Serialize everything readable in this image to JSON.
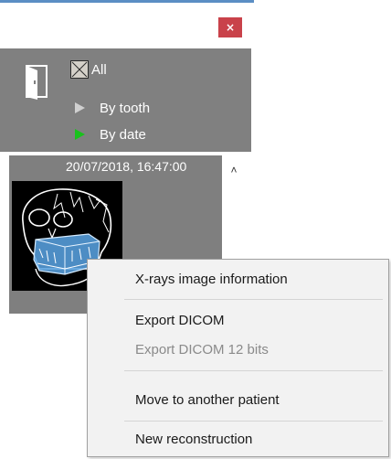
{
  "window": {
    "close_glyph": "×",
    "accent_line_color": "#5b8ec4",
    "close_color": "#c9424a"
  },
  "filters": {
    "all_label": "All",
    "by_tooth_label": "By tooth",
    "by_date_label": "By date",
    "panel_color": "#808080",
    "active_color": "#19c21c",
    "active_filter": "By date"
  },
  "images": [
    {
      "datetime": "20/07/2018, 16:47:00",
      "thumbnail": "skull-xray-3d-icon"
    }
  ],
  "scroll": {
    "up_glyph": "˄"
  },
  "context_menu": {
    "items": [
      {
        "label": "X-rays image information",
        "enabled": true
      },
      {
        "label": "Export DICOM",
        "enabled": true
      },
      {
        "label": "Export DICOM 12 bits",
        "enabled": false
      },
      {
        "label": "Move to another patient",
        "enabled": true
      },
      {
        "label": "New reconstruction",
        "enabled": true
      }
    ]
  }
}
